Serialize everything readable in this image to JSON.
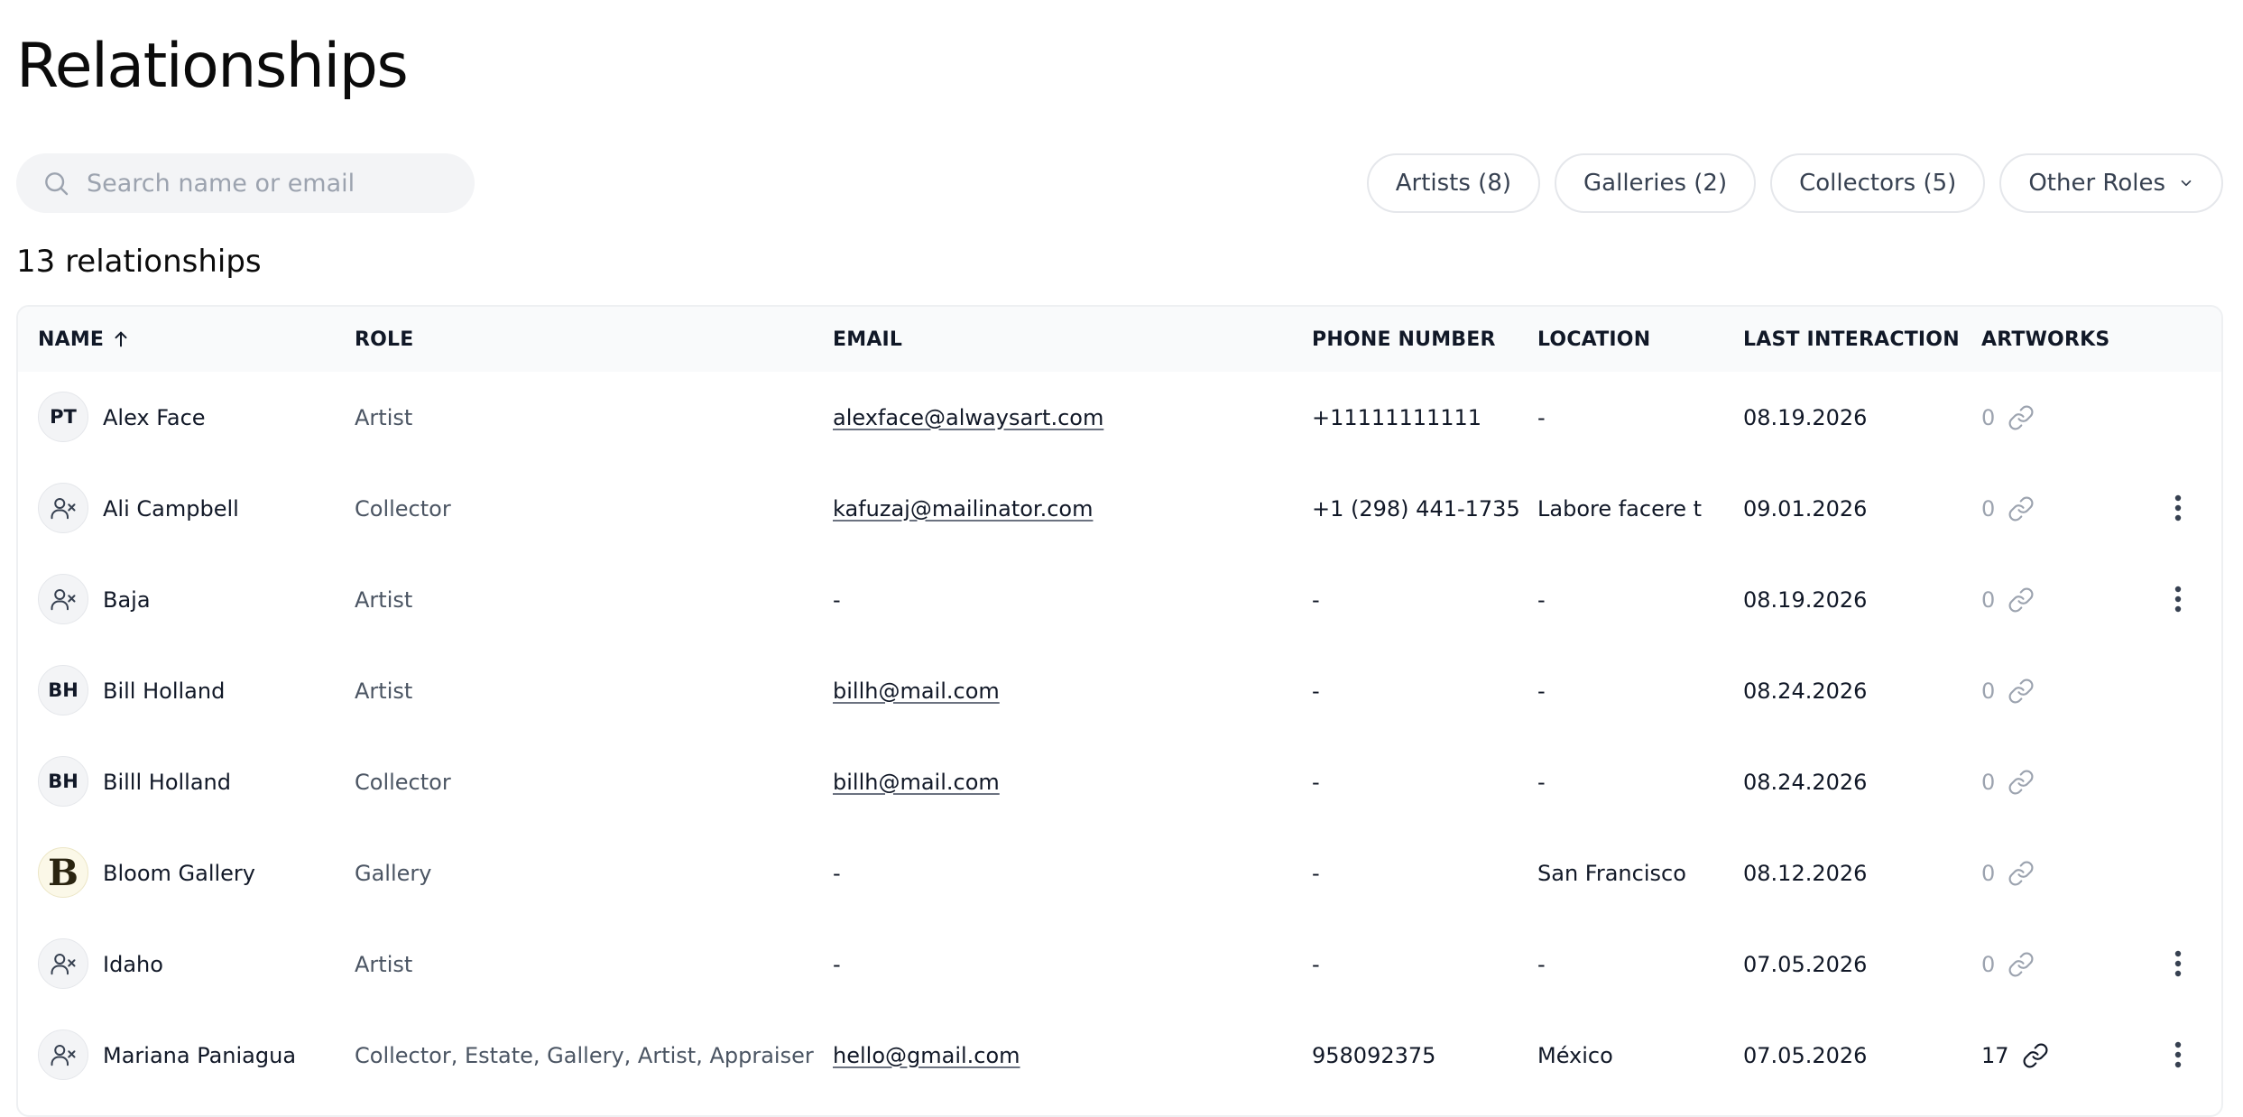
{
  "page": {
    "title": "Relationships"
  },
  "search": {
    "placeholder": "Search name or email",
    "value": ""
  },
  "filters": [
    {
      "label": "Artists (8)"
    },
    {
      "label": "Galleries (2)"
    },
    {
      "label": "Collectors (5)"
    },
    {
      "label": "Other Roles",
      "icon": "chevron-down-icon"
    }
  ],
  "summary": {
    "count_text": "13 relationships"
  },
  "table": {
    "headers": {
      "name": "NAME",
      "role": "ROLE",
      "email": "EMAIL",
      "phone": "PHONE NUMBER",
      "location": "LOCATION",
      "last_interaction": "LAST INTERACTION",
      "artworks": "ARTWORKS"
    },
    "sort": {
      "column": "name",
      "direction": "ascending",
      "icon": "arrow-up-icon"
    },
    "rows": [
      {
        "avatar_type": "initials",
        "initials": "PT",
        "name": "Alex Face",
        "role": "Artist",
        "email": "alexface@alwaysart.com",
        "phone": "+11111111111",
        "location": "-",
        "last_interaction": "08.19.2026",
        "artworks": "0",
        "has_menu": false
      },
      {
        "avatar_type": "icon",
        "avatar_icon": "user-x-icon",
        "name": "Ali Campbell",
        "role": "Collector",
        "email": "kafuzaj@mailinator.com",
        "phone": "+1 (298) 441-1735",
        "location": "Labore facere t",
        "last_interaction": "09.01.2026",
        "artworks": "0",
        "has_menu": true
      },
      {
        "avatar_type": "icon",
        "avatar_icon": "user-x-icon",
        "name": "Baja",
        "role": "Artist",
        "email": "-",
        "phone": "-",
        "location": "-",
        "last_interaction": "08.19.2026",
        "artworks": "0",
        "has_menu": true
      },
      {
        "avatar_type": "initials",
        "initials": "BH",
        "name": "Bill Holland",
        "role": "Artist",
        "email": "billh@mail.com",
        "phone": "-",
        "location": "-",
        "last_interaction": "08.24.2026",
        "artworks": "0",
        "has_menu": false
      },
      {
        "avatar_type": "initials",
        "initials": "BH",
        "name": "Billl Holland",
        "role": "Collector",
        "email": "billh@mail.com",
        "phone": "-",
        "location": "-",
        "last_interaction": "08.24.2026",
        "artworks": "0",
        "has_menu": false
      },
      {
        "avatar_type": "logo",
        "initials": "B",
        "name": "Bloom Gallery",
        "role": "Gallery",
        "email": "-",
        "phone": "-",
        "location": "San Francisco",
        "last_interaction": "08.12.2026",
        "artworks": "0",
        "has_menu": false
      },
      {
        "avatar_type": "icon",
        "avatar_icon": "user-x-icon",
        "name": "Idaho",
        "role": "Artist",
        "email": "-",
        "phone": "-",
        "location": "-",
        "last_interaction": "07.05.2026",
        "artworks": "0",
        "has_menu": true
      },
      {
        "avatar_type": "icon",
        "avatar_icon": "user-x-icon",
        "name": "Mariana Paniagua",
        "role": "Collector, Estate, Gallery, Artist, Appraiser",
        "email": "hello@gmail.com",
        "phone": "958092375",
        "location": "México",
        "last_interaction": "07.05.2026",
        "artworks": "17",
        "has_menu": true
      }
    ]
  },
  "icons": {
    "search": "search-icon",
    "artworks_link": "link-icon",
    "row_menu": "more-vertical-icon"
  }
}
